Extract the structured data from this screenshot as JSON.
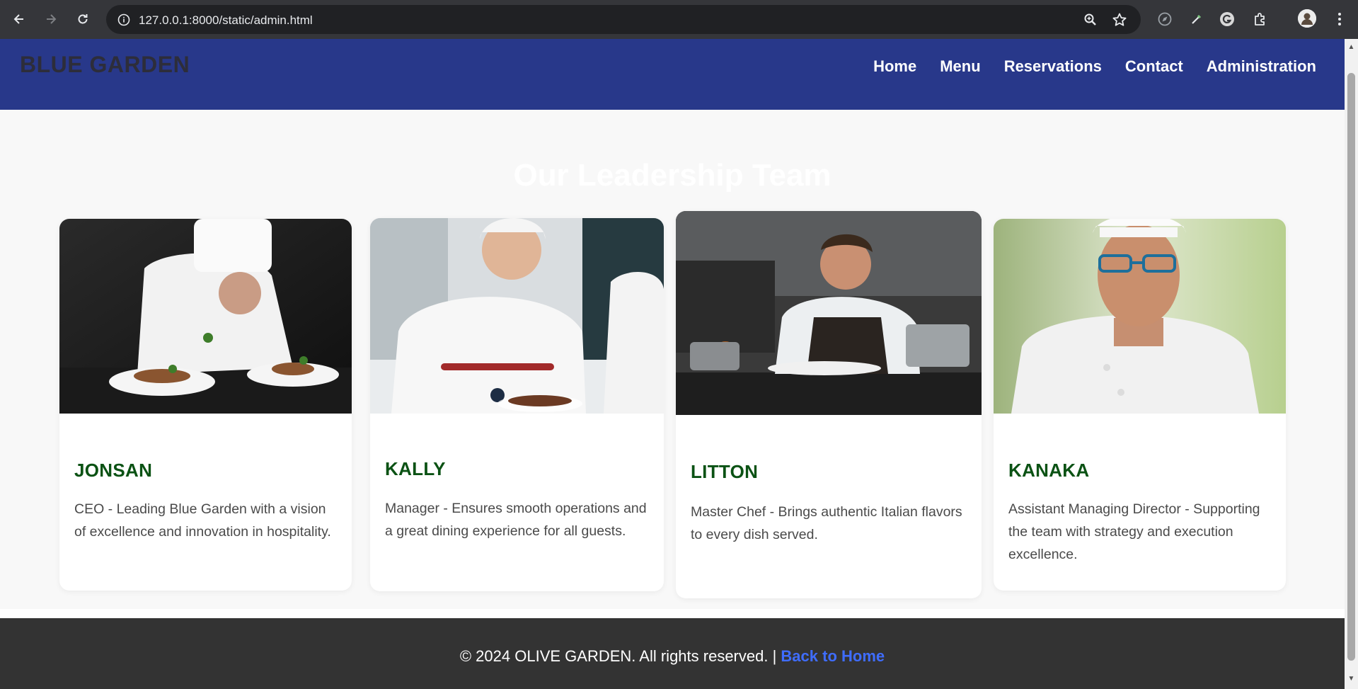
{
  "browser": {
    "url": "127.0.0.1:8000/static/admin.html",
    "icons": [
      "back-icon",
      "forward-icon",
      "reload-icon",
      "site-info-icon",
      "zoom-icon",
      "star-icon",
      "compass-extension-icon",
      "eyedropper-extension-icon",
      "grammarly-extension-icon",
      "extensions-puzzle-icon",
      "profile-avatar-icon",
      "more-menu-icon"
    ]
  },
  "header": {
    "brand": "BLUE GARDEN",
    "nav": [
      "Home",
      "Menu",
      "Reservations",
      "Contact",
      "Administration"
    ],
    "background": "#28388a"
  },
  "main": {
    "title": "Our Leadership Team",
    "team": [
      {
        "name": "JONSAN",
        "role": "CEO - Leading Blue Garden with a vision of excellence and innovation in hospitality."
      },
      {
        "name": "KALLY",
        "role": "Manager - Ensures smooth operations and a great dining experience for all guests."
      },
      {
        "name": "LITTON",
        "role": "Master Chef - Brings authentic Italian flavors to every dish served."
      },
      {
        "name": "KANAKA",
        "role": "Assistant Managing Director - Supporting the team with strategy and execution excellence."
      }
    ],
    "name_color": "#0b5214"
  },
  "footer": {
    "text": "© 2024 OLIVE GARDEN. All rights reserved. | ",
    "link": "Back to Home",
    "link_color": "#3f6dff"
  }
}
